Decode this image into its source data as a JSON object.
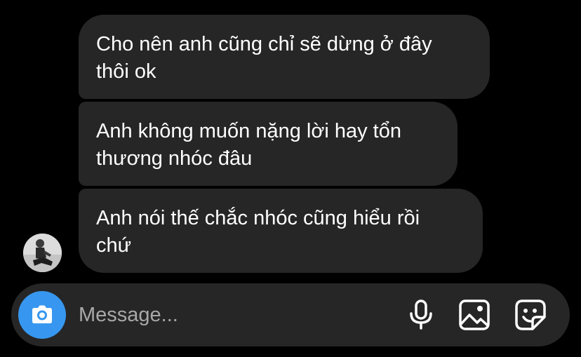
{
  "conversation": {
    "messages": [
      {
        "text": "Cho nên anh cũng chỉ sẽ dừng ở đây\nthôi ok"
      },
      {
        "text": "Anh không muốn nặng lời hay tổn\nthương nhóc đâu"
      },
      {
        "text": "Anh nói thế chắc nhóc cũng hiểu rồi\nchứ"
      }
    ]
  },
  "composer": {
    "placeholder": "Message...",
    "camera_icon": "camera-icon",
    "mic_icon": "microphone-icon",
    "gallery_icon": "image-icon",
    "sticker_icon": "sticker-icon"
  },
  "colors": {
    "background": "#000000",
    "bubble": "#262626",
    "composer": "#262626",
    "accent": "#3797f0",
    "placeholder": "#a8a8a8"
  }
}
